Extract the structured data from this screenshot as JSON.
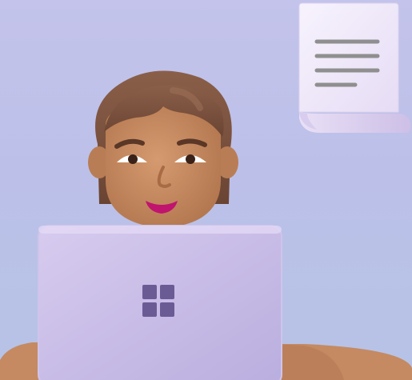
{
  "scene": {
    "description_alt": "",
    "document_lines": 4
  },
  "colors": {
    "background_top": "#c3c3eb",
    "background_bottom": "#b6c3e6",
    "laptop": "#c9bde6",
    "laptop_logo": "#6b5b95",
    "hair": "#7a5340",
    "skin": "#c58a62",
    "mouth": "#c0146e",
    "document_paper": "#f3eefb",
    "document_lines": "#8f8f8f"
  },
  "icons": {
    "document": "document-icon",
    "laptop_logo": "windows-logo-icon",
    "person": "person-avatar"
  }
}
